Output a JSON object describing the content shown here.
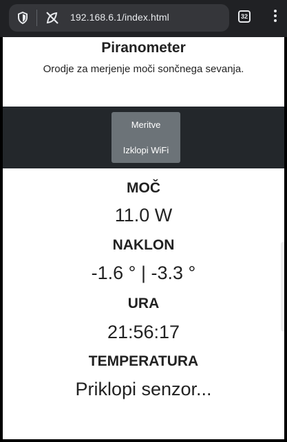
{
  "browser": {
    "url": "192.168.6.1/index.html",
    "tab_count": "32",
    "icons": {
      "shield": "shield-icon",
      "tracker": "tracker-blocked-icon",
      "menu": "more-vert-icon"
    }
  },
  "header": {
    "title": "Piranometer",
    "subtitle": "Orodje za merjenje moči sončnega sevanja."
  },
  "nav": {
    "measurements_label": "Meritve",
    "wifi_off_label": "Izklopi WiFi"
  },
  "readings": [
    {
      "label": "MOČ",
      "value": "11.0 W"
    },
    {
      "label": "NAKLON",
      "value": "-1.6 ° | -3.3 °"
    },
    {
      "label": "URA",
      "value": "21:56:17"
    },
    {
      "label": "TEMPERATURA",
      "value": "Priklopi senzor..."
    }
  ],
  "colors": {
    "chrome_bg": "#202124",
    "omnibox_bg": "#35363a",
    "nav_bg": "#23272b",
    "button_bg": "#6c7378",
    "page_bg": "#ffffff",
    "text": "#222222"
  }
}
